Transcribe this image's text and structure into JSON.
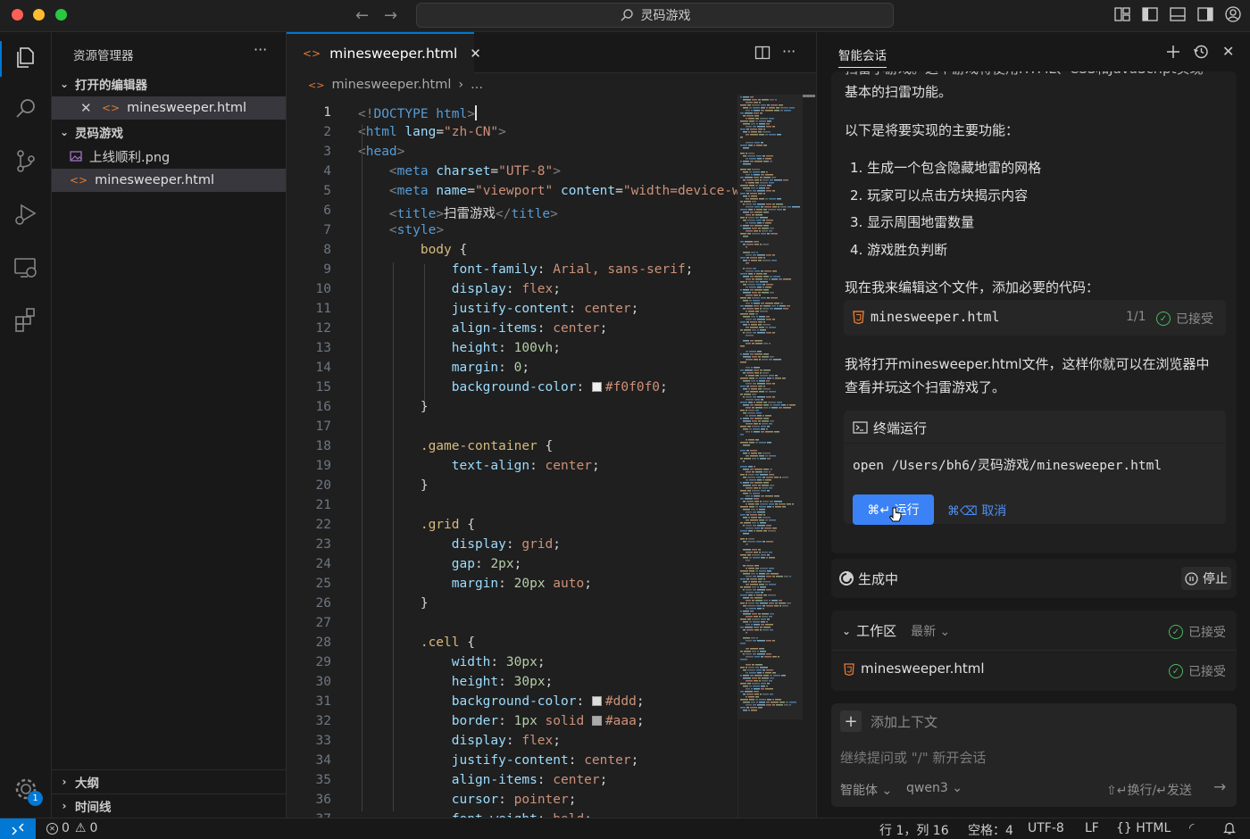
{
  "titlebar": {
    "search_text": "灵码游戏"
  },
  "sidebar": {
    "title": "资源管理器",
    "open_editors_label": "打开的编辑器",
    "open_editor_file": "minesweeper.html",
    "folder_label": "灵码游戏",
    "files": [
      "上线顺利.png",
      "minesweeper.html"
    ],
    "outline_label": "大纲",
    "timeline_label": "时间线"
  },
  "activity": {
    "settings_badge": "1"
  },
  "editor": {
    "tab_label": "minesweeper.html",
    "breadcrumb_file": "minesweeper.html",
    "breadcrumb_more": "...",
    "lines": [
      [
        [
          "t-br",
          "<!"
        ],
        [
          "t-tag",
          "DOCTYPE html"
        ],
        [
          "t-br",
          ">"
        ]
      ],
      [
        [
          "t-br",
          "<"
        ],
        [
          "t-tag",
          "html "
        ],
        [
          "t-attr",
          "lang"
        ],
        [
          "t-punc",
          "="
        ],
        [
          "t-str",
          "\"zh-CN\""
        ],
        [
          "t-br",
          ">"
        ]
      ],
      [
        [
          "t-br",
          "<"
        ],
        [
          "t-tag",
          "head"
        ],
        [
          "t-br",
          ">"
        ]
      ],
      [
        [
          "t-punc",
          "    "
        ],
        [
          "t-br",
          "<"
        ],
        [
          "t-tag",
          "meta "
        ],
        [
          "t-attr",
          "charset"
        ],
        [
          "t-punc",
          "="
        ],
        [
          "t-str",
          "\"UTF-8\""
        ],
        [
          "t-br",
          ">"
        ]
      ],
      [
        [
          "t-punc",
          "    "
        ],
        [
          "t-br",
          "<"
        ],
        [
          "t-tag",
          "meta "
        ],
        [
          "t-attr",
          "name"
        ],
        [
          "t-punc",
          "="
        ],
        [
          "t-str",
          "\"viewport\" "
        ],
        [
          "t-attr",
          "content"
        ],
        [
          "t-punc",
          "="
        ],
        [
          "t-str",
          "\"width=device-w"
        ]
      ],
      [
        [
          "t-punc",
          "    "
        ],
        [
          "t-br",
          "<"
        ],
        [
          "t-tag",
          "title"
        ],
        [
          "t-br",
          ">"
        ],
        [
          "t-punc",
          "扫雷游戏"
        ],
        [
          "t-br",
          "</"
        ],
        [
          "t-tag",
          "title"
        ],
        [
          "t-br",
          ">"
        ]
      ],
      [
        [
          "t-punc",
          "    "
        ],
        [
          "t-br",
          "<"
        ],
        [
          "t-tag",
          "style"
        ],
        [
          "t-br",
          ">"
        ]
      ],
      [
        [
          "t-punc",
          "        "
        ],
        [
          "t-sel",
          "body "
        ],
        [
          "t-punc",
          "{"
        ]
      ],
      [
        [
          "t-punc",
          "            "
        ],
        [
          "t-prop",
          "font-family"
        ],
        [
          "t-punc",
          ": "
        ],
        [
          "t-val",
          "Arial, sans-serif"
        ],
        [
          "t-punc",
          ";"
        ]
      ],
      [
        [
          "t-punc",
          "            "
        ],
        [
          "t-prop",
          "display"
        ],
        [
          "t-punc",
          ": "
        ],
        [
          "t-val",
          "flex"
        ],
        [
          "t-punc",
          ";"
        ]
      ],
      [
        [
          "t-punc",
          "            "
        ],
        [
          "t-prop",
          "justify-content"
        ],
        [
          "t-punc",
          ": "
        ],
        [
          "t-val",
          "center"
        ],
        [
          "t-punc",
          ";"
        ]
      ],
      [
        [
          "t-punc",
          "            "
        ],
        [
          "t-prop",
          "align-items"
        ],
        [
          "t-punc",
          ": "
        ],
        [
          "t-val",
          "center"
        ],
        [
          "t-punc",
          ";"
        ]
      ],
      [
        [
          "t-punc",
          "            "
        ],
        [
          "t-prop",
          "height"
        ],
        [
          "t-punc",
          ": "
        ],
        [
          "t-num",
          "100vh"
        ],
        [
          "t-punc",
          ";"
        ]
      ],
      [
        [
          "t-punc",
          "            "
        ],
        [
          "t-prop",
          "margin"
        ],
        [
          "t-punc",
          ": "
        ],
        [
          "t-num",
          "0"
        ],
        [
          "t-punc",
          ";"
        ]
      ],
      [
        [
          "t-punc",
          "            "
        ],
        [
          "t-prop",
          "background-color"
        ],
        [
          "t-punc",
          ": "
        ],
        [
          "swatch:#f0f0f0",
          ""
        ],
        [
          "t-val",
          "#f0f0f0"
        ],
        [
          "t-punc",
          ";"
        ]
      ],
      [
        [
          "t-punc",
          "        }"
        ]
      ],
      [],
      [
        [
          "t-punc",
          "        "
        ],
        [
          "t-sel",
          ".game-container "
        ],
        [
          "t-punc",
          "{"
        ]
      ],
      [
        [
          "t-punc",
          "            "
        ],
        [
          "t-prop",
          "text-align"
        ],
        [
          "t-punc",
          ": "
        ],
        [
          "t-val",
          "center"
        ],
        [
          "t-punc",
          ";"
        ]
      ],
      [
        [
          "t-punc",
          "        }"
        ]
      ],
      [],
      [
        [
          "t-punc",
          "        "
        ],
        [
          "t-sel",
          ".grid "
        ],
        [
          "t-punc",
          "{"
        ]
      ],
      [
        [
          "t-punc",
          "            "
        ],
        [
          "t-prop",
          "display"
        ],
        [
          "t-punc",
          ": "
        ],
        [
          "t-val",
          "grid"
        ],
        [
          "t-punc",
          ";"
        ]
      ],
      [
        [
          "t-punc",
          "            "
        ],
        [
          "t-prop",
          "gap"
        ],
        [
          "t-punc",
          ": "
        ],
        [
          "t-num",
          "2px"
        ],
        [
          "t-punc",
          ";"
        ]
      ],
      [
        [
          "t-punc",
          "            "
        ],
        [
          "t-prop",
          "margin"
        ],
        [
          "t-punc",
          ": "
        ],
        [
          "t-num",
          "20px "
        ],
        [
          "t-val",
          "auto"
        ],
        [
          "t-punc",
          ";"
        ]
      ],
      [
        [
          "t-punc",
          "        }"
        ]
      ],
      [],
      [
        [
          "t-punc",
          "        "
        ],
        [
          "t-sel",
          ".cell "
        ],
        [
          "t-punc",
          "{"
        ]
      ],
      [
        [
          "t-punc",
          "            "
        ],
        [
          "t-prop",
          "width"
        ],
        [
          "t-punc",
          ": "
        ],
        [
          "t-num",
          "30px"
        ],
        [
          "t-punc",
          ";"
        ]
      ],
      [
        [
          "t-punc",
          "            "
        ],
        [
          "t-prop",
          "height"
        ],
        [
          "t-punc",
          ": "
        ],
        [
          "t-num",
          "30px"
        ],
        [
          "t-punc",
          ";"
        ]
      ],
      [
        [
          "t-punc",
          "            "
        ],
        [
          "t-prop",
          "background-color"
        ],
        [
          "t-punc",
          ": "
        ],
        [
          "swatch:#dddddd",
          ""
        ],
        [
          "t-val",
          "#ddd"
        ],
        [
          "t-punc",
          ";"
        ]
      ],
      [
        [
          "t-punc",
          "            "
        ],
        [
          "t-prop",
          "border"
        ],
        [
          "t-punc",
          ": "
        ],
        [
          "t-num",
          "1px "
        ],
        [
          "t-val",
          "solid "
        ],
        [
          "swatch:#aaaaaa",
          ""
        ],
        [
          "t-val",
          "#aaa"
        ],
        [
          "t-punc",
          ";"
        ]
      ],
      [
        [
          "t-punc",
          "            "
        ],
        [
          "t-prop",
          "display"
        ],
        [
          "t-punc",
          ": "
        ],
        [
          "t-val",
          "flex"
        ],
        [
          "t-punc",
          ";"
        ]
      ],
      [
        [
          "t-punc",
          "            "
        ],
        [
          "t-prop",
          "justify-content"
        ],
        [
          "t-punc",
          ": "
        ],
        [
          "t-val",
          "center"
        ],
        [
          "t-punc",
          ";"
        ]
      ],
      [
        [
          "t-punc",
          "            "
        ],
        [
          "t-prop",
          "align-items"
        ],
        [
          "t-punc",
          ": "
        ],
        [
          "t-val",
          "center"
        ],
        [
          "t-punc",
          ";"
        ]
      ],
      [
        [
          "t-punc",
          "            "
        ],
        [
          "t-prop",
          "cursor"
        ],
        [
          "t-punc",
          ": "
        ],
        [
          "t-val",
          "pointer"
        ],
        [
          "t-punc",
          ";"
        ]
      ],
      [
        [
          "t-punc",
          "            "
        ],
        [
          "t-prop",
          "font-weight"
        ],
        [
          "t-punc",
          ": "
        ],
        [
          "t-val",
          "bold"
        ],
        [
          "t-punc",
          ";"
        ]
      ]
    ]
  },
  "chat": {
    "title": "智能会话",
    "intro_tail": "扫雷小游戏。这个游戏将使用HTML、CSS和JavaScript实现",
    "intro_line2": "基本的扫雷功能。",
    "features_heading": "以下是将要实现的主要功能：",
    "features": [
      "1. 生成一个包含隐藏地雷的网格",
      "2. 玩家可以点击方块揭示内容",
      "3. 显示周围地雷数量",
      "4. 游戏胜负判断"
    ],
    "edit_intro": "现在我来编辑这个文件，添加必要的代码：",
    "file_card": {
      "name": "minesweeper.html",
      "count": "1/1",
      "status": "已接受"
    },
    "open_line1": "我将打开minesweeper.html文件，这样你就可以在浏览器中",
    "open_line2": "查看并玩这个扫雷游戏了。",
    "terminal": {
      "title": "终端运行",
      "command": "open /Users/bh6/灵码游戏/minesweeper.html",
      "run_label": "⌘↵ 运行",
      "cancel_label": "⌘⌫ 取消"
    },
    "generating_label": "生成中",
    "stop_label": "停止",
    "workspace": {
      "label": "工作区",
      "filter": "最新",
      "status": "已接受",
      "file": "minesweeper.html",
      "file_status": "已接受"
    },
    "input": {
      "add_context": "添加上下文",
      "placeholder": "继续提问或 \"/\" 新开会话",
      "agent": "智能体",
      "model": "qwen3",
      "hint": "⇧↵换行/↵发送"
    }
  },
  "statusbar": {
    "errors": "0",
    "warnings": "0",
    "position": "行 1，列 16",
    "spaces": "空格：4",
    "encoding": "UTF-8",
    "eol": "LF",
    "language": "HTML"
  }
}
